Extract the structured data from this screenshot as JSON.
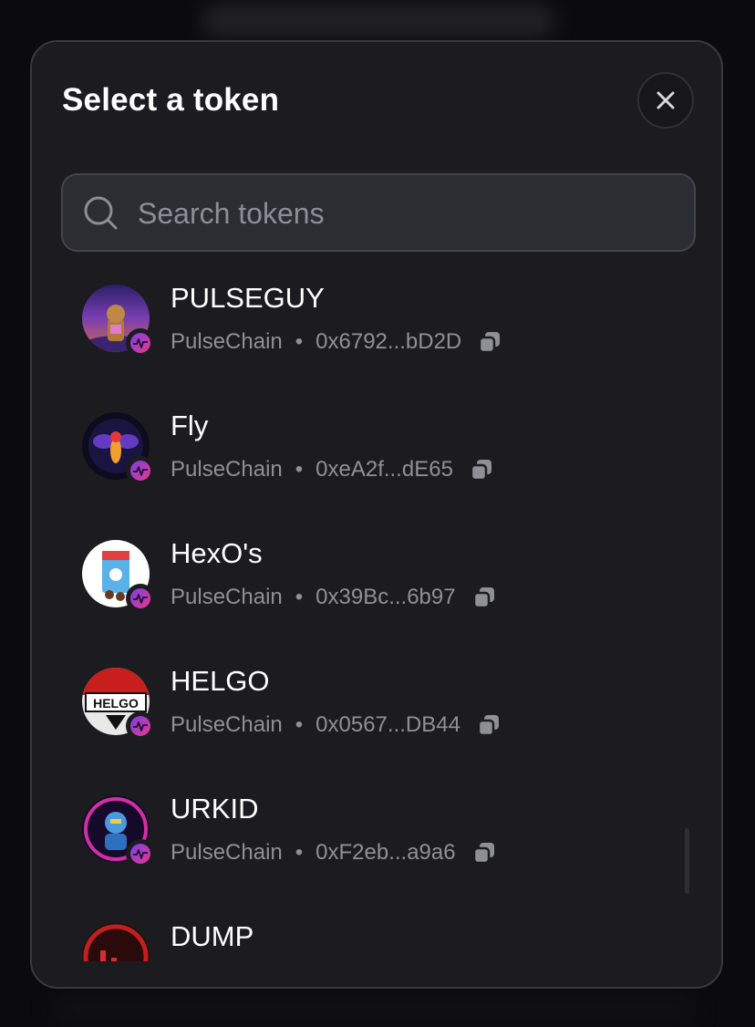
{
  "modal": {
    "title": "Select a token",
    "close_label": "×"
  },
  "search": {
    "placeholder": "Search tokens",
    "value": ""
  },
  "tokens": [
    {
      "symbol": "PULSEGUY",
      "chain": "PulseChain",
      "address": "0x6792...bD2D",
      "icon": "pulseguy-avatar"
    },
    {
      "symbol": "Fly",
      "chain": "PulseChain",
      "address": "0xeA2f...dE65",
      "icon": "fly-avatar"
    },
    {
      "symbol": "HexO's",
      "chain": "PulseChain",
      "address": "0x39Bc...6b97",
      "icon": "hexos-avatar"
    },
    {
      "symbol": "HELGO",
      "chain": "PulseChain",
      "address": "0x0567...DB44",
      "icon": "helgo-avatar",
      "logo_text": "HELGO"
    },
    {
      "symbol": "URKID",
      "chain": "PulseChain",
      "address": "0xF2eb...a9a6",
      "icon": "urkid-avatar"
    },
    {
      "symbol": "DUMP",
      "chain": "",
      "address": "",
      "icon": "dump-avatar"
    }
  ],
  "meta_separator": "•",
  "colors": {
    "background": "#0b0b0d",
    "modal": "#1c1c20",
    "search": "#2c2c33",
    "text_primary": "#ffffff",
    "text_secondary": "#8f8f96",
    "chain_badge_gradient": [
      "#7b3fe4",
      "#e6388d"
    ]
  }
}
